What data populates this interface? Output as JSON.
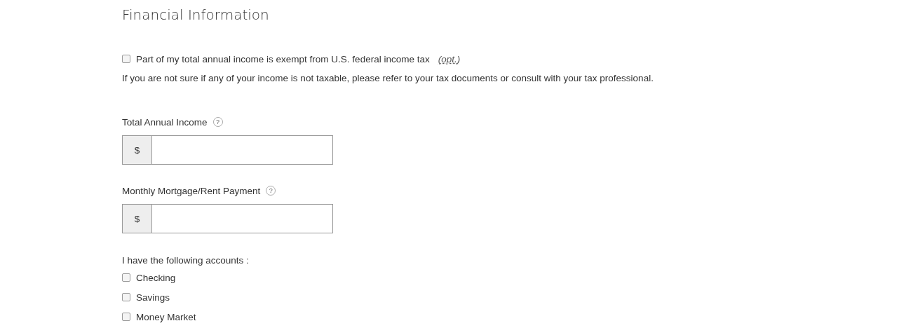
{
  "heading": "Financial Information",
  "exempt": {
    "label": "Part of my total annual income is exempt from U.S. federal income tax",
    "optional_tag": "(opt.)",
    "checked": false
  },
  "note": "If you are not sure if any of your income is not taxable, please refer to your tax documents or consult with your tax professional.",
  "fields": [
    {
      "label": "Total Annual Income",
      "help": "?",
      "prefix": "$"
    },
    {
      "label": "Monthly Mortgage/Rent Payment",
      "help": "?",
      "prefix": "$"
    }
  ],
  "accounts": {
    "label": "I have the following accounts :",
    "options": [
      {
        "label": "Checking",
        "checked": false
      },
      {
        "label": "Savings",
        "checked": false
      },
      {
        "label": "Money Market",
        "checked": false
      }
    ]
  }
}
